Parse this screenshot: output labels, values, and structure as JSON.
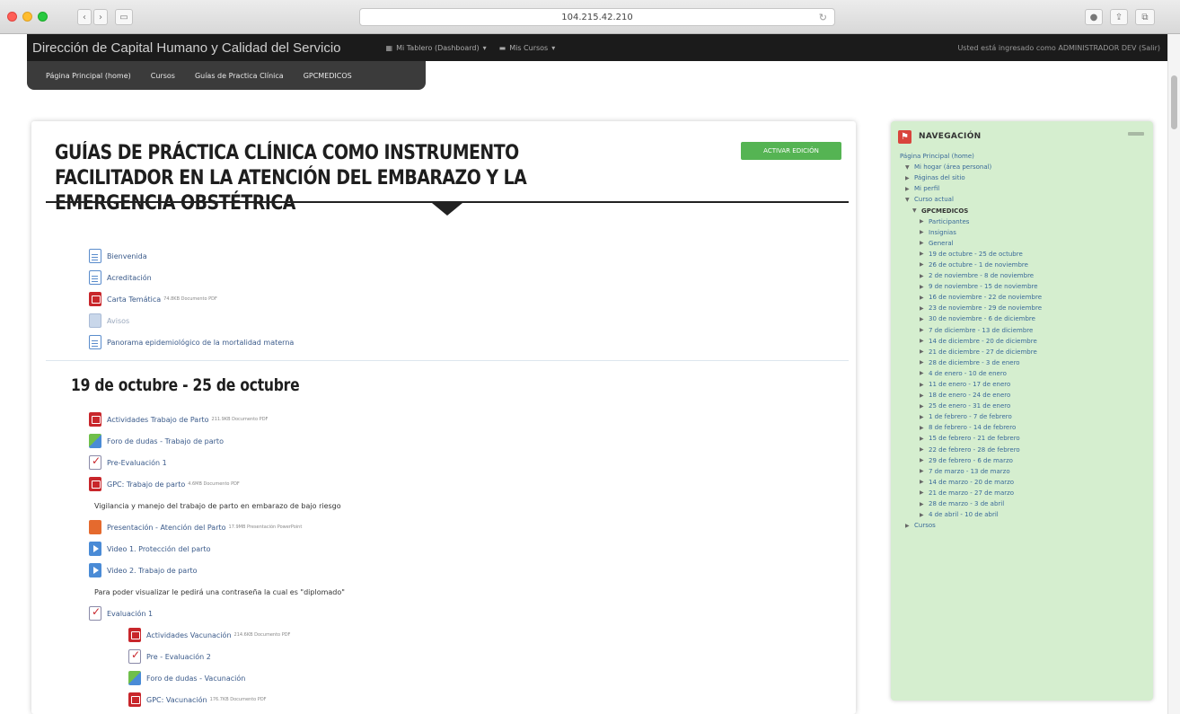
{
  "browser": {
    "url": "104.215.42.210"
  },
  "topbar": {
    "site_name": "Dirección de Capital Humano y Calidad del Servicio",
    "menu_dashboard": "Mi Tablero (Dashboard)",
    "menu_courses": "Mis Cursos",
    "user_info": "Usted está ingresado como ADMINISTRADOR DEV (Salir)"
  },
  "subnav": {
    "items": [
      {
        "label": "Página Principal (home)"
      },
      {
        "label": "Cursos"
      },
      {
        "label": "Guías de Practica Clínica"
      },
      {
        "label": "GPCMEDICOS"
      }
    ]
  },
  "course": {
    "title": "GUÍAS DE PRÁCTICA CLÍNICA COMO INSTRUMENTO FACILITADOR EN LA ATENCIÓN DEL EMBARAZO Y LA EMERGENCIA OBSTÉTRICA",
    "edit_button": "ACTIVAR EDICIÓN"
  },
  "intro_activities": [
    {
      "label": "Bienvenida",
      "meta": ""
    },
    {
      "label": "Acreditación",
      "meta": ""
    },
    {
      "label": "Carta Temática",
      "meta": "74.8KB Documento PDF"
    },
    {
      "label": "Avisos",
      "meta": ""
    },
    {
      "label": "Panorama epidemiológico de la mortalidad materna",
      "meta": ""
    }
  ],
  "section1": {
    "title": "19 de octubre - 25 de octubre",
    "items": [
      {
        "label": "Actividades Trabajo de Parto",
        "meta": "211.9KB Documento PDF"
      },
      {
        "label": "Foro de dudas - Trabajo de parto",
        "meta": ""
      },
      {
        "label": "Pre-Evaluación 1",
        "meta": ""
      },
      {
        "label": "GPC: Trabajo de parto",
        "meta": "4.6MB Documento PDF"
      },
      {
        "label": "Vigilancia y manejo del trabajo de parto en embarazo de bajo riesgo",
        "meta": ""
      },
      {
        "label": "Presentación - Atención del Parto",
        "meta": "17.9MB Presentación PowerPoint"
      },
      {
        "label": "Video 1. Protección del parto",
        "meta": ""
      },
      {
        "label": "Video 2. Trabajo de parto",
        "meta": ""
      },
      {
        "label": "Para poder visualizar le pedirá una contraseña la cual es \"diplomado\"",
        "meta": ""
      },
      {
        "label": "Evaluación 1",
        "meta": ""
      },
      {
        "label": "Actividades Vacunación",
        "meta": "214.6KB Documento PDF"
      },
      {
        "label": "Pre - Evaluación 2",
        "meta": ""
      },
      {
        "label": "Foro de dudas - Vacunación",
        "meta": ""
      },
      {
        "label": "GPC: Vacunación",
        "meta": "176.7KB Documento PDF"
      }
    ]
  },
  "navigation": {
    "title": "NAVEGACIÓN",
    "nodes": [
      {
        "label": "Página Principal (home)"
      },
      {
        "label": "Mi hogar (área personal)"
      },
      {
        "label": "Páginas del sitio"
      },
      {
        "label": "Mi perfil"
      },
      {
        "label": "Curso actual"
      },
      {
        "label": "GPCMEDICOS"
      },
      {
        "label": "Participantes"
      },
      {
        "label": "Insignias"
      },
      {
        "label": "General"
      },
      {
        "label": "19 de octubre - 25 de octubre"
      },
      {
        "label": "26 de octubre - 1 de noviembre"
      },
      {
        "label": "2 de noviembre - 8 de noviembre"
      },
      {
        "label": "9 de noviembre - 15 de noviembre"
      },
      {
        "label": "16 de noviembre - 22 de noviembre"
      },
      {
        "label": "23 de noviembre - 29 de noviembre"
      },
      {
        "label": "30 de noviembre - 6 de diciembre"
      },
      {
        "label": "7 de diciembre - 13 de diciembre"
      },
      {
        "label": "14 de diciembre - 20 de diciembre"
      },
      {
        "label": "21 de diciembre - 27 de diciembre"
      },
      {
        "label": "28 de diciembre - 3 de enero"
      },
      {
        "label": "4 de enero - 10 de enero"
      },
      {
        "label": "11 de enero - 17 de enero"
      },
      {
        "label": "18 de enero - 24 de enero"
      },
      {
        "label": "25 de enero - 31 de enero"
      },
      {
        "label": "1 de febrero - 7 de febrero"
      },
      {
        "label": "8 de febrero - 14 de febrero"
      },
      {
        "label": "15 de febrero - 21 de febrero"
      },
      {
        "label": "22 de febrero - 28 de febrero"
      },
      {
        "label": "29 de febrero - 6 de marzo"
      },
      {
        "label": "7 de marzo - 13 de marzo"
      },
      {
        "label": "14 de marzo - 20 de marzo"
      },
      {
        "label": "21 de marzo - 27 de marzo"
      },
      {
        "label": "28 de marzo - 3 de abril"
      },
      {
        "label": "4 de abril - 10 de abril"
      },
      {
        "label": "Cursos"
      }
    ]
  },
  "colors": {
    "topbar": "#1b1b1b",
    "edit_button": "#55b453",
    "nav_panel": "#d5eecf",
    "link": "#3a5a8a"
  }
}
